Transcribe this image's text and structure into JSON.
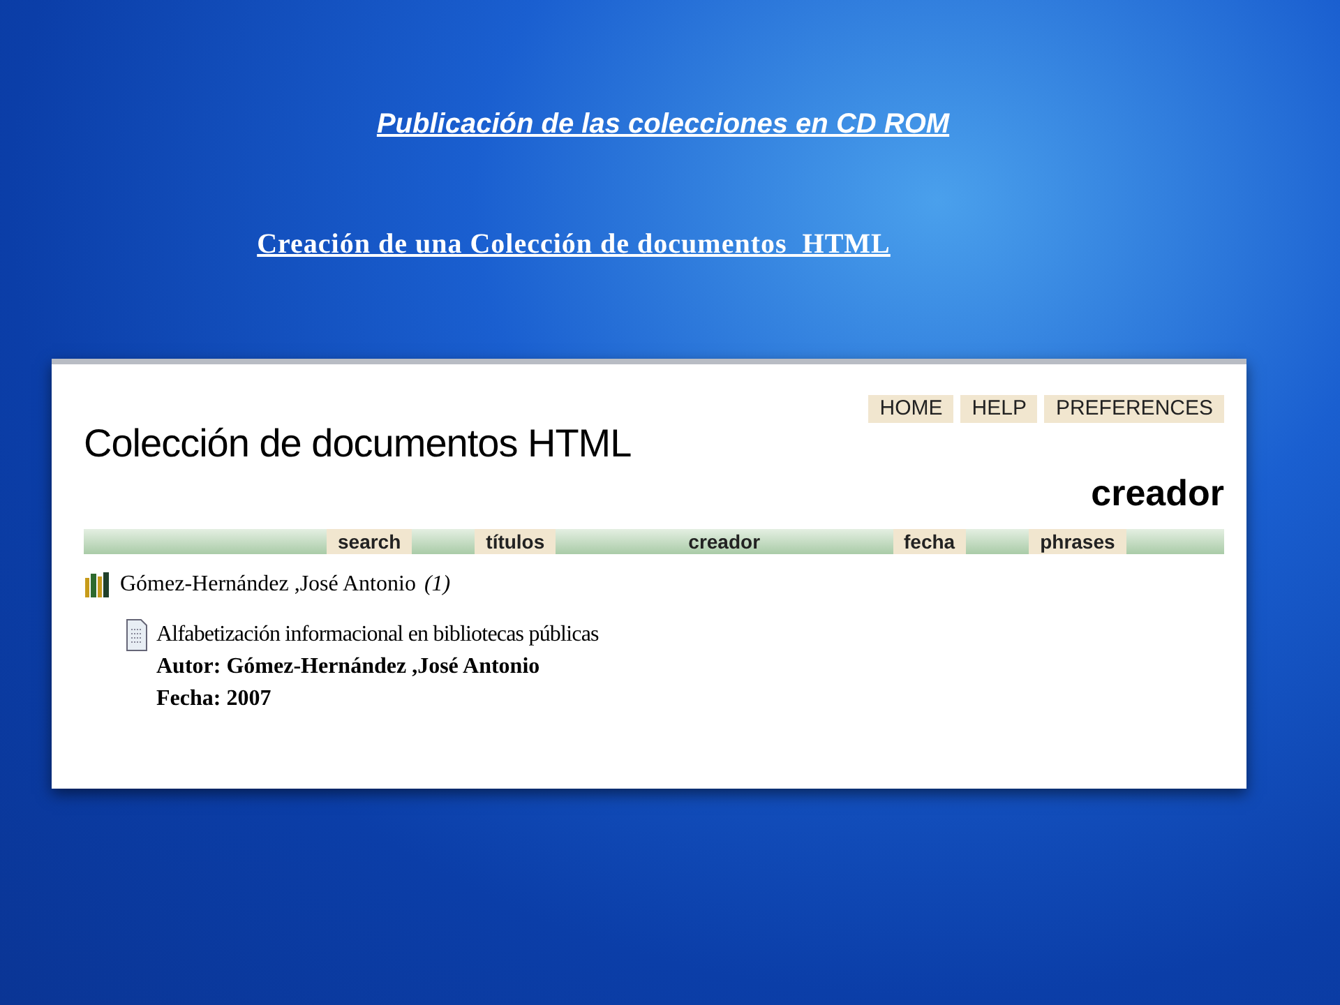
{
  "slide": {
    "title": "Publicación de las colecciones en CD ROM",
    "subtitle": "Creación de una Colección de documentos  HTML"
  },
  "collection": {
    "title": "Colección de documentos HTML",
    "top_links": [
      "HOME",
      "HELP",
      "PREFERENCES"
    ],
    "page_heading": "creador",
    "tabs": [
      {
        "label": "search",
        "selected": false
      },
      {
        "label": "títulos",
        "selected": false
      },
      {
        "label": "creador",
        "selected": true
      },
      {
        "label": "fecha",
        "selected": false
      },
      {
        "label": "phrases",
        "selected": false
      }
    ],
    "group": {
      "name": "Gómez-Hernández ,José Antonio",
      "count": "(1)",
      "documents": [
        {
          "title": "Alfabetización informacional en bibliotecas públicas",
          "author": "Autor: Gómez-Hernández ,José Antonio",
          "date": "Fecha: 2007"
        }
      ]
    }
  }
}
